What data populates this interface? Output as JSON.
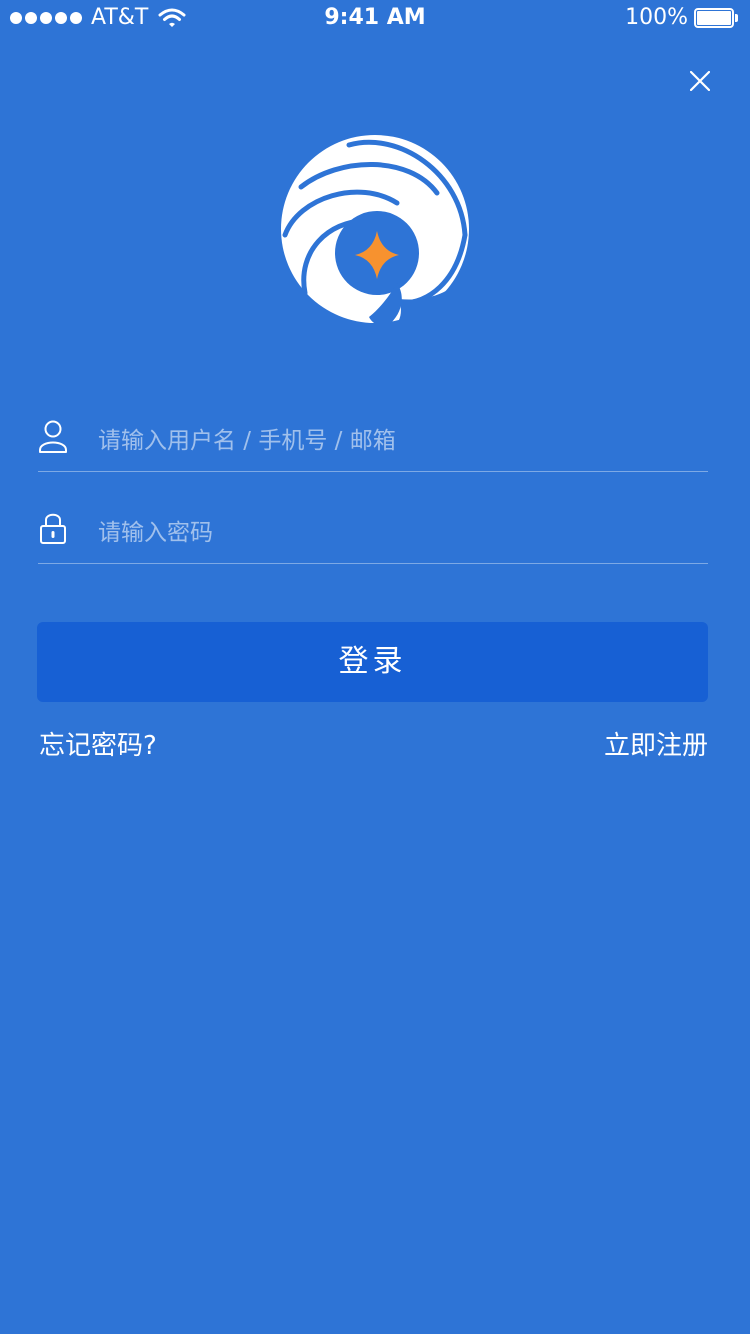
{
  "status_bar": {
    "carrier": "AT&T",
    "time": "9:41 AM",
    "battery_text": "100%",
    "battery_level": 1.0,
    "signal_strength": 5,
    "icons": [
      "signal-dots-icon",
      "wifi-icon",
      "battery-icon"
    ]
  },
  "close_icon": "close-icon",
  "logo_icon": "app-logo-icon",
  "form": {
    "username": {
      "icon": "user-icon",
      "placeholder": "请输入用户名 / 手机号 / 邮箱",
      "value": ""
    },
    "password": {
      "icon": "lock-icon",
      "placeholder": "请输入密码",
      "value": ""
    },
    "login_label": "登录"
  },
  "links": {
    "forgot_password": "忘记密码?",
    "register": "立即注册"
  },
  "colors": {
    "background": "#2E74D6",
    "button": "#1760D4",
    "accent": "#F7922F",
    "text": "#FFFFFF"
  }
}
